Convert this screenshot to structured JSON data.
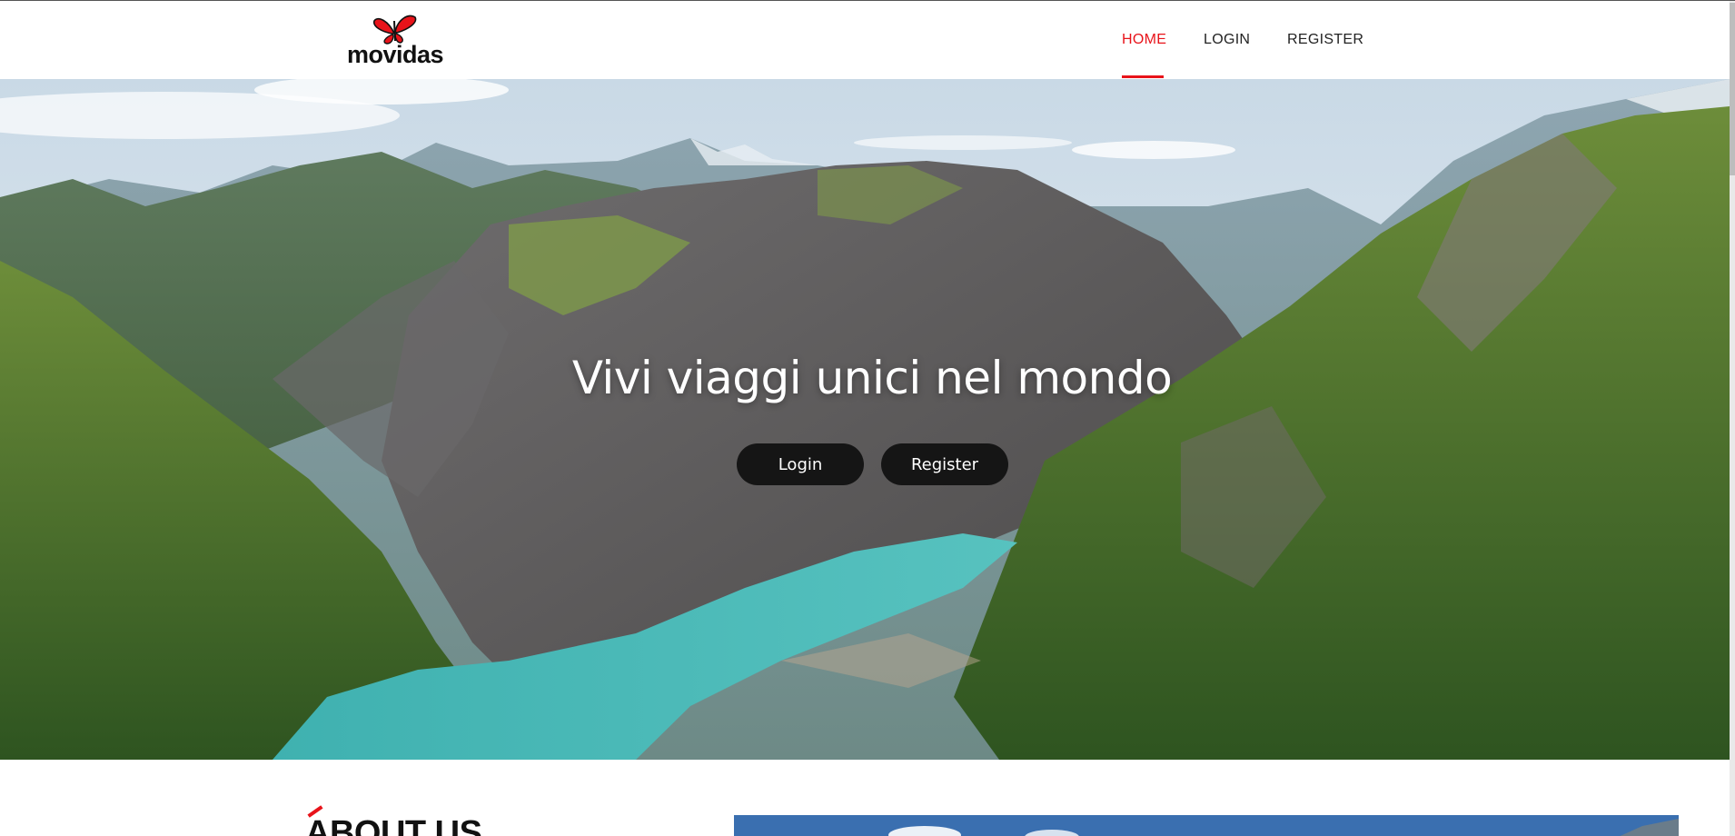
{
  "brand": {
    "name": "movidas",
    "accent_color": "#e8131a"
  },
  "nav": {
    "items": [
      {
        "label": "HOME",
        "active": true
      },
      {
        "label": "LOGIN",
        "active": false
      },
      {
        "label": "REGISTER",
        "active": false
      }
    ]
  },
  "hero": {
    "title": "Vivi viaggi unici nel mondo",
    "login_label": "Login",
    "register_label": "Register"
  },
  "about": {
    "title": "ABOUT US"
  }
}
